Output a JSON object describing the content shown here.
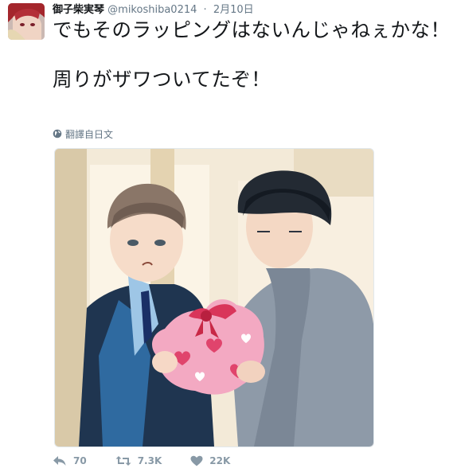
{
  "tweet": {
    "display_name": "御子柴実琴",
    "handle": "@mikoshiba0214",
    "separator": "·",
    "date": "2月10日",
    "text": "でもそのラッピングはないんじゃねぇかな！\n\n周りがザワついてたぞ！",
    "translate_label": "翻譯自日文"
  },
  "actions": {
    "reply_count": "70",
    "retweet_count": "7.3K",
    "like_count": "22K"
  },
  "icons": {
    "globe": "globe-icon",
    "reply": "reply-icon",
    "retweet": "retweet-icon",
    "like": "heart-icon"
  },
  "colors": {
    "text": "#14171a",
    "secondary": "#657786",
    "action": "#8899a6"
  }
}
